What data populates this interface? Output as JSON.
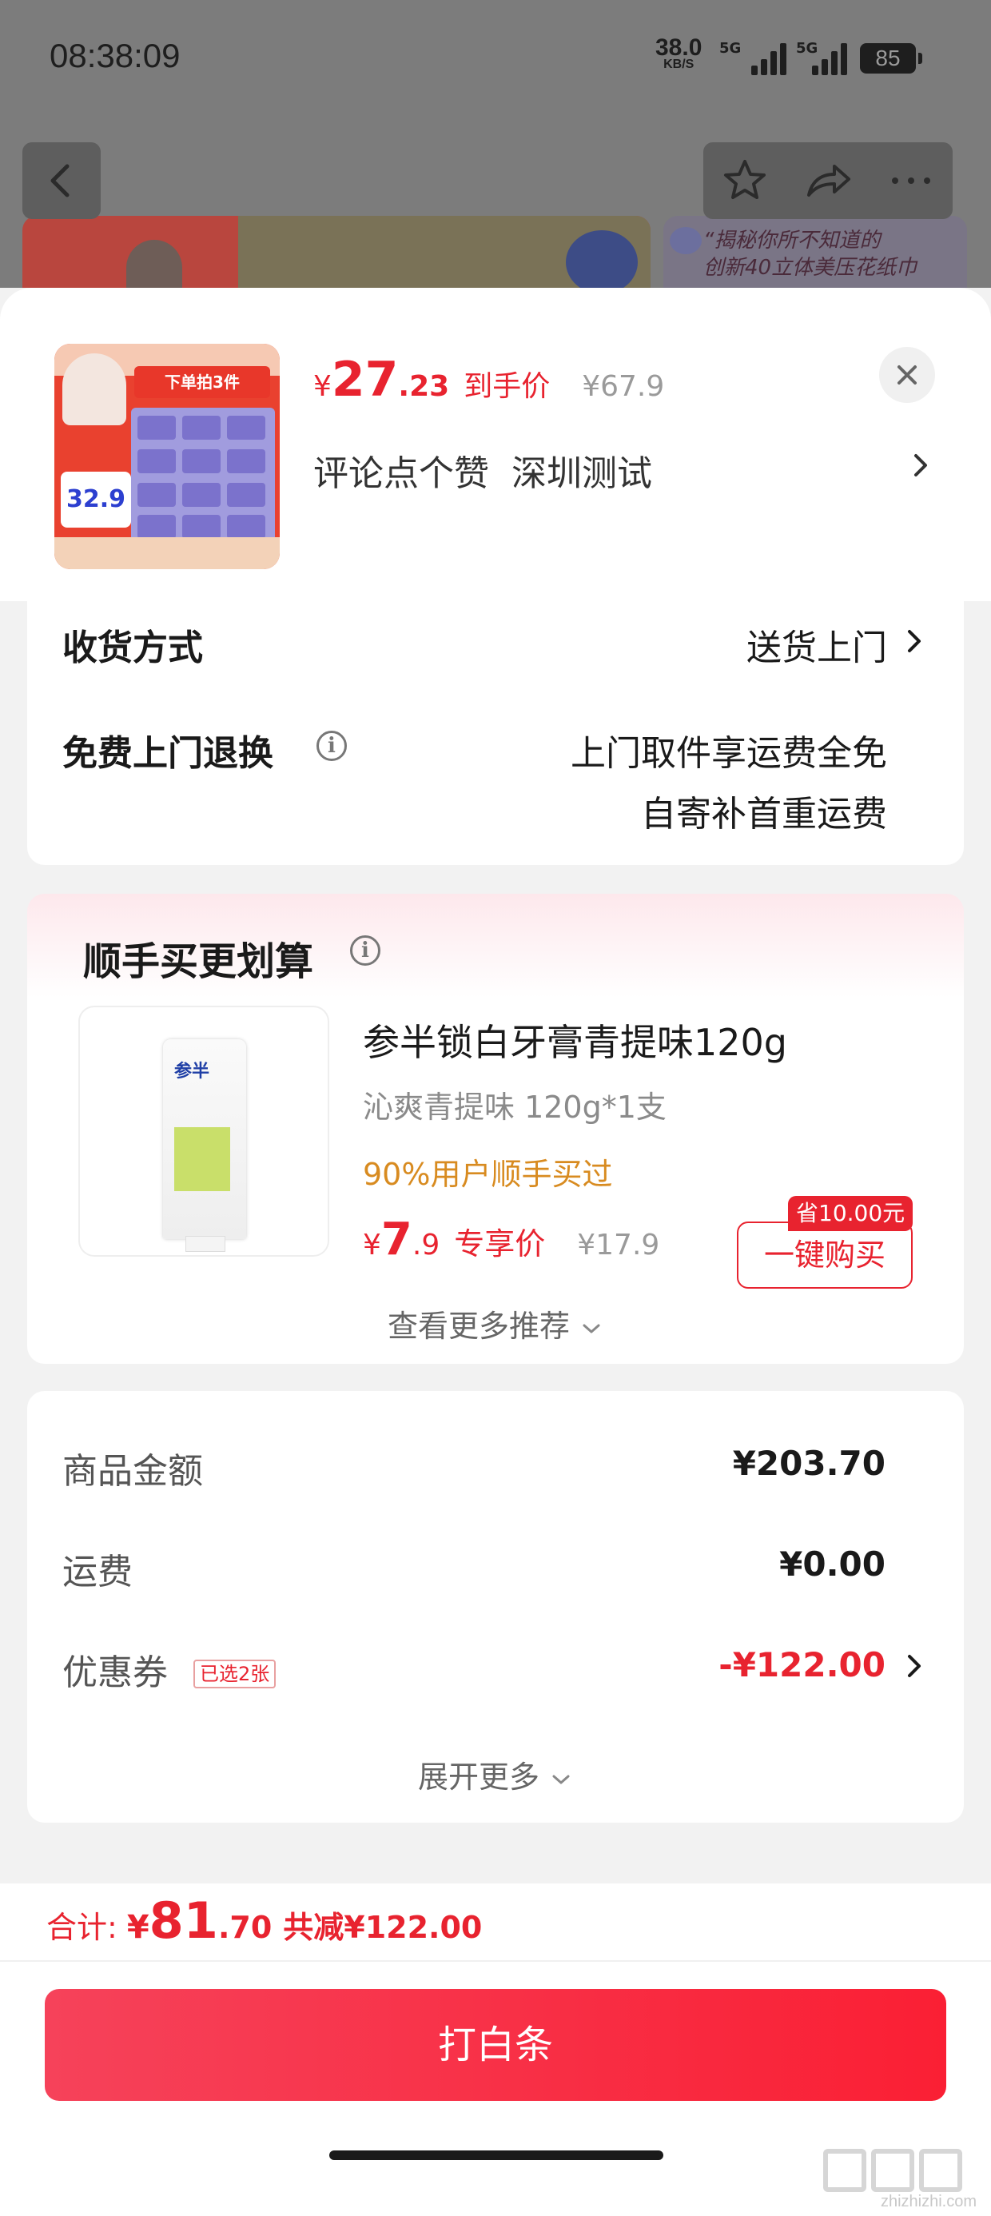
{
  "status_bar": {
    "time": "08:38:09",
    "net_speed": "38.0",
    "net_unit": "KB/S",
    "sim1": "5G",
    "sim2": "5G",
    "battery": "85"
  },
  "background_page": {
    "banner_text_line1": "“揭秘你所不知道的",
    "banner_text_line2": "创新40立体美压花纸巾"
  },
  "product": {
    "thumb_banner": "下单拍3件",
    "thumb_price": "32.9",
    "price_currency": "¥",
    "price_int": "27",
    "price_dec": ".23",
    "price_tag": "到手价",
    "orig_price": "¥67.9",
    "address_name": "评论点个赞",
    "address_city": "深圳测试"
  },
  "delivery": {
    "method_label": "收货方式",
    "method_value": "送货上门",
    "return_label": "免费上门退换",
    "return_line1": "上门取件享运费全免",
    "return_line2": "自寄补首重运费"
  },
  "recommend": {
    "title": "顺手买更划算",
    "image_brand": "参半",
    "item_name": "参半锁白牙膏青提味120g",
    "item_spec": "沁爽青提味 120g*1支",
    "item_rate": "90%用户顺手买过",
    "price_currency": "¥",
    "price_int": "7",
    "price_dec": ".9",
    "price_tag": "专享价",
    "orig_price": "¥17.9",
    "save_badge": "省10.00元",
    "buy_label": "一键购买",
    "more_label": "查看更多推荐"
  },
  "summary": {
    "goods_label": "商品金额",
    "goods_value": "¥203.70",
    "shipping_label": "运费",
    "shipping_value": "¥0.00",
    "coupon_label": "优惠券",
    "coupon_badge": "已选2张",
    "coupon_value": "-¥122.00",
    "expand_label": "展开更多"
  },
  "footer": {
    "total_label": "合计:",
    "total_currency": "¥",
    "total_int": "81",
    "total_dec": ".70",
    "total_off": "共减¥122.00",
    "pay_button": "打白条",
    "watermark": "zhizhizhi.com"
  },
  "colors": {
    "accent_red": "#e8232f",
    "rate_orange": "#d88b20"
  }
}
